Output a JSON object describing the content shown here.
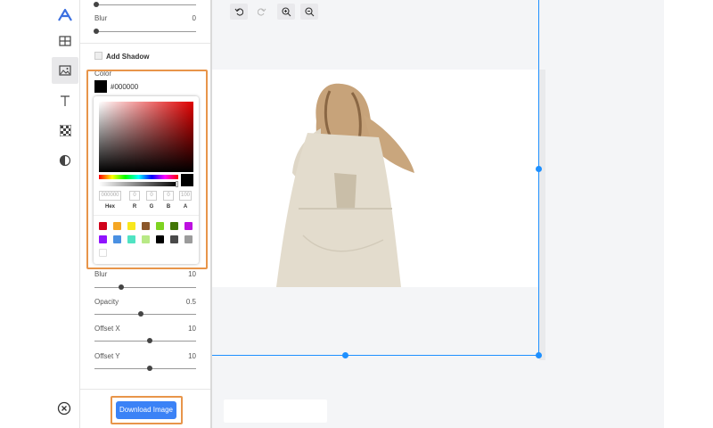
{
  "sidebar": {
    "icons": [
      "logo-icon",
      "table-icon",
      "image-icon",
      "text-icon",
      "pattern-icon",
      "contrast-icon",
      "close-circle-icon"
    ]
  },
  "panel": {
    "blur_top": {
      "label": "Blur",
      "value": "0",
      "level": 0
    },
    "add_shadow_label": "Add Shadow",
    "color_label": "Color",
    "color_hex": "#000000",
    "picker": {
      "hex_value": "000000",
      "r": "0",
      "g": "0",
      "b": "0",
      "a": "100",
      "labels": {
        "hex": "Hex",
        "r": "R",
        "g": "G",
        "b": "B",
        "a": "A"
      },
      "swatches": [
        "#d0021b",
        "#f5a623",
        "#f8e71c",
        "#8b572a",
        "#7ed321",
        "#417505",
        "#bd10e0",
        "#9013fe",
        "#4a90e2",
        "#50e3c2",
        "#b8e986",
        "#000000",
        "#4a4a4a",
        "#9b9b9b",
        "#ffffff"
      ]
    },
    "blur": {
      "label": "Blur",
      "value": "10",
      "level": 0.25
    },
    "opacity": {
      "label": "Opacity",
      "value": "0.5",
      "level": 0.5
    },
    "offset_x": {
      "label": "Offset X",
      "value": "10",
      "level": 0.55
    },
    "offset_y": {
      "label": "Offset Y",
      "value": "10",
      "level": 0.55
    },
    "download_label": "Download Image"
  },
  "toolbar": {
    "buttons": [
      "undo-icon",
      "redo-icon",
      "zoom-in-icon",
      "zoom-out-icon"
    ]
  },
  "colors": {
    "accent": "#1e90ff",
    "highlight": "#e8954a",
    "download": "#3b82f6"
  }
}
